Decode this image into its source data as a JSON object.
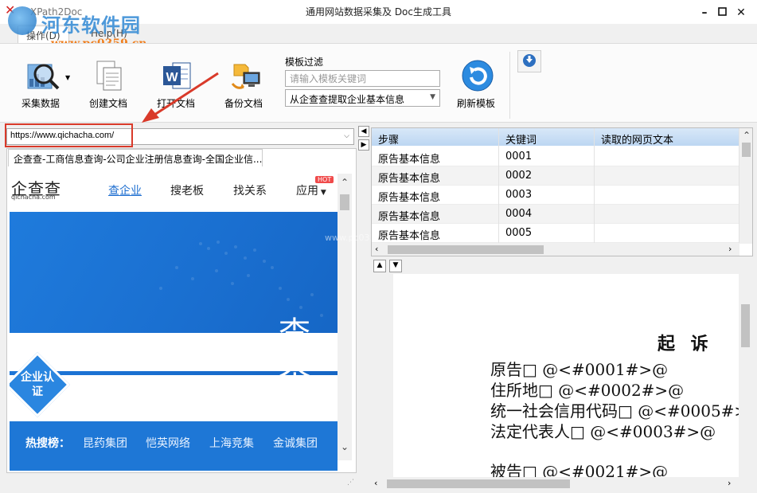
{
  "window": {
    "app_name": "XPath2Doc",
    "title": "通用网站数据采集及 Doc生成工具",
    "min_icon": "minimize-icon",
    "max_icon": "maximize-icon",
    "close_icon": "close-icon"
  },
  "menu": {
    "tabs": [
      {
        "label": "操作(D)",
        "active": true
      },
      {
        "label": "Help(H)",
        "active": false
      }
    ]
  },
  "watermark": {
    "site_name": "河东软件园",
    "url": "www.pc0359.cn",
    "url_small": "www.pc0359.cn"
  },
  "toolbar": {
    "collect_label": "采集数据",
    "create_doc_label": "创建文档",
    "open_doc_label": "打开文档",
    "backup_doc_label": "备份文档",
    "refresh_label": "刷新模板",
    "filter_label": "模板过滤",
    "filter_placeholder": "请输入模板关键词",
    "template_selected": "从企查查提取企业基本信息"
  },
  "url_bar": {
    "value": "https://www.qichacha.com/"
  },
  "browser": {
    "tab_title": "企查查-工商信息查询-公司企业注册信息查询-全国企业信...",
    "site": {
      "logo": "企查查",
      "logo_sub": "qichacha.com",
      "nav": [
        "查企业",
        "搜老板",
        "找关系",
        "应用"
      ],
      "hot_badge": "HOT",
      "banner_text": "查企",
      "badge_text": "企业认证",
      "hot_search_label": "热搜榜：",
      "hot_items": [
        "昆药集团",
        "恺英网络",
        "上海竞集",
        "金诚集团"
      ]
    }
  },
  "grid": {
    "columns": [
      "步骤",
      "关键词",
      "读取的网页文本"
    ],
    "rows": [
      [
        "原告基本信息",
        "0001",
        ""
      ],
      [
        "原告基本信息",
        "0002",
        ""
      ],
      [
        "原告基本信息",
        "0003",
        ""
      ],
      [
        "原告基本信息",
        "0004",
        ""
      ],
      [
        "原告基本信息",
        "0005",
        ""
      ]
    ]
  },
  "doc_preview": {
    "heading": "起  诉",
    "lines": [
      "原告□ @<#0001#>@",
      "住所地□ @<#0002#>@",
      "统一社会信用代码□ @<#0005#>",
      "法定代表人□ @<#0003#>@",
      "被告□ @<#0021#>@"
    ]
  },
  "colors": {
    "accent": "#1f7bdc",
    "highlight_outline": "#d93a2a",
    "grid_header": "#bcd6f2"
  }
}
